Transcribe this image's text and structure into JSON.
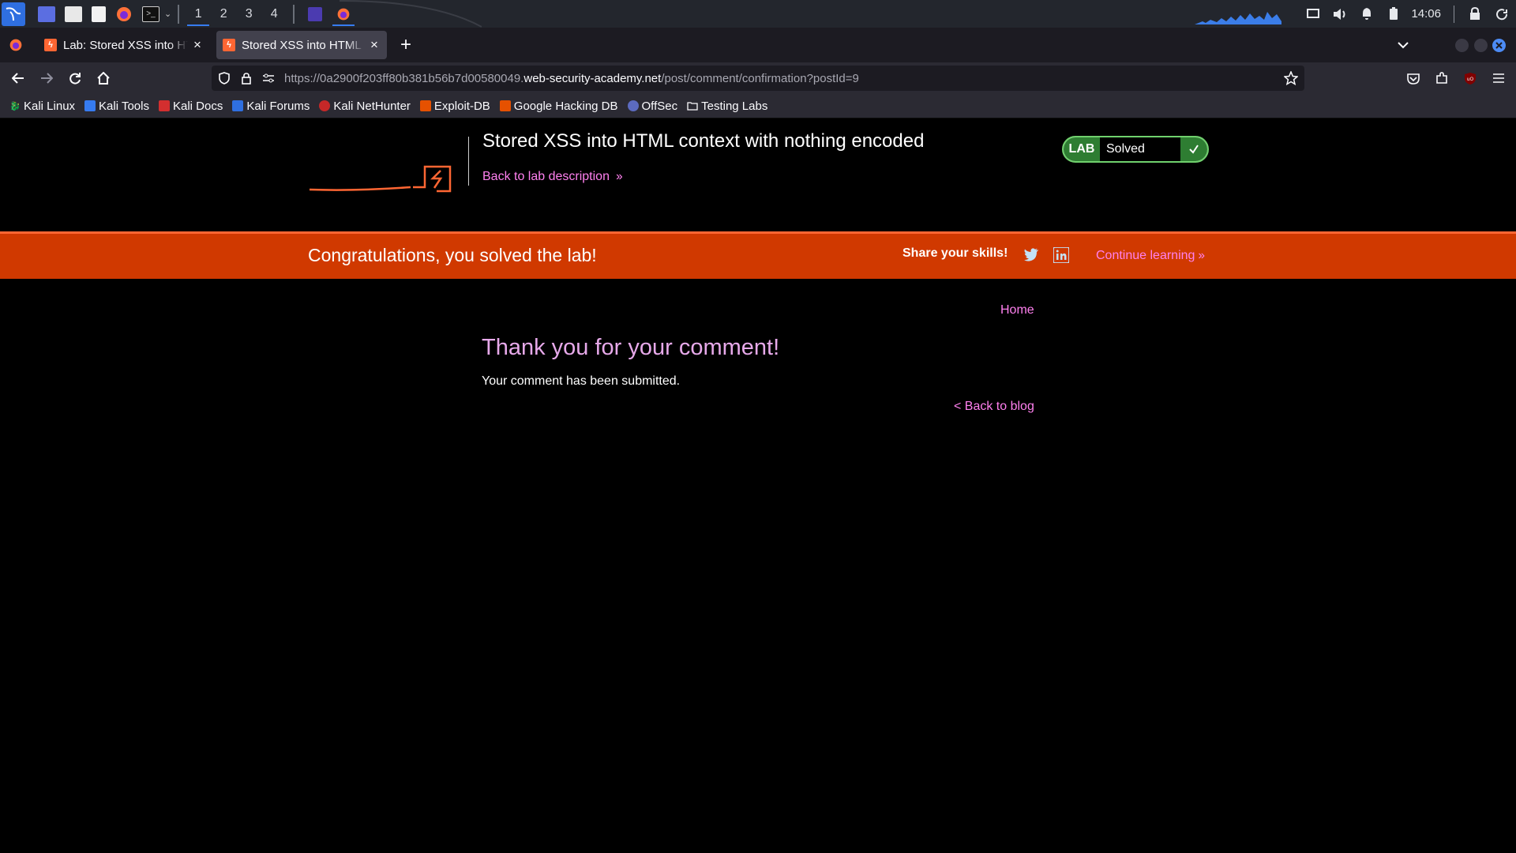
{
  "os_panel": {
    "workspaces": [
      "1",
      "2",
      "3",
      "4"
    ],
    "active_workspace": "1",
    "clock": "14:06",
    "icons": [
      "kali-menu-icon",
      "desktop-icon",
      "file-manager-icon",
      "text-editor-icon",
      "firefox-icon",
      "terminal-icon",
      "burp-icon",
      "display-icon",
      "volume-icon",
      "bell-icon",
      "battery-icon",
      "lock-icon",
      "power-icon"
    ]
  },
  "browser": {
    "tabs": [
      {
        "title": "Lab: Stored XSS into HTML context with nothing encoded",
        "active": false
      },
      {
        "title": "Stored XSS into HTML context with nothing encoded",
        "active": true
      }
    ],
    "url": {
      "prefix": "https://0a2900f203ff80b381b56b7d00580049.",
      "domain": "web-security-academy.net",
      "path": "/post/comment/confirmation?postId=9"
    },
    "bookmarks": [
      "Kali Linux",
      "Kali Tools",
      "Kali Docs",
      "Kali Forums",
      "Kali NetHunter",
      "Exploit-DB",
      "Google Hacking DB",
      "OffSec",
      "Testing Labs"
    ]
  },
  "lab_header": {
    "title": "Stored XSS into HTML context with nothing encoded",
    "back_link": "Back to lab description",
    "badge_label": "LAB",
    "status": "Solved"
  },
  "banner": {
    "message": "Congratulations, you solved the lab!",
    "share_label": "Share your skills!",
    "continue_label": "Continue learning"
  },
  "content": {
    "home_link": "Home",
    "heading": "Thank you for your comment!",
    "message": "Your comment has been submitted.",
    "back_link": "< Back to blog"
  },
  "colors": {
    "banner_bg": "#d03900",
    "link": "#ff80ef",
    "heading": "#e7a9ea",
    "lab_green": "#2e7d32",
    "brand_orange": "#ff6633"
  }
}
